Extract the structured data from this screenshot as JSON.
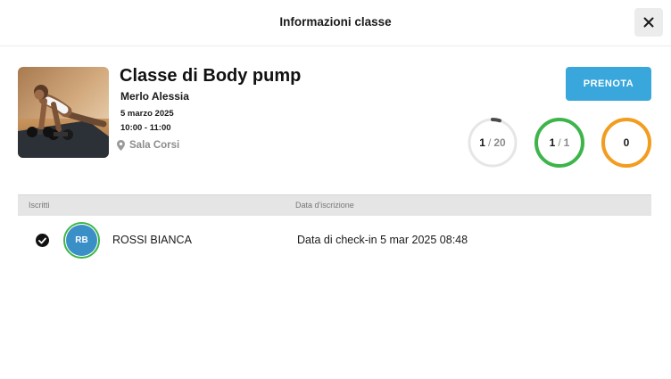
{
  "modal": {
    "title": "Informazioni classe",
    "close_icon": "close-icon"
  },
  "class": {
    "name": "Classe di Body pump",
    "instructor": "Merlo Alessia",
    "date": "5 marzo 2025",
    "time": "10:00 - 11:00",
    "room": "Sala Corsi",
    "room_icon": "map-pin-icon",
    "photo_icon": "woman-doing-pushup-with-dumbbells"
  },
  "book_button": {
    "label": "PRENOTA",
    "color": "#3aa7dc"
  },
  "stats": [
    {
      "value": "1",
      "total": "20",
      "fraction": 0.05,
      "color": "#4a4a4a",
      "track": "#e6e6e6"
    },
    {
      "value": "1",
      "total": "1",
      "fraction": 1.0,
      "color": "#3db54a",
      "track": "#e6e6e6"
    },
    {
      "value": "0",
      "fraction": 1.0,
      "color": "#f39c1e",
      "track": "#e6e6e6"
    }
  ],
  "table": {
    "columns": [
      "Iscritti",
      "Data d'iscrizione"
    ],
    "rows": [
      {
        "checked": true,
        "initials": "RB",
        "name": "ROSSI BIANCA",
        "checkin": "Data di check-in 5 mar 2025 08:48"
      }
    ]
  },
  "colors": {
    "accent": "#3aa7dc",
    "success": "#3db54a",
    "warning": "#f39c1e",
    "avatar": "#3a8fc7"
  }
}
